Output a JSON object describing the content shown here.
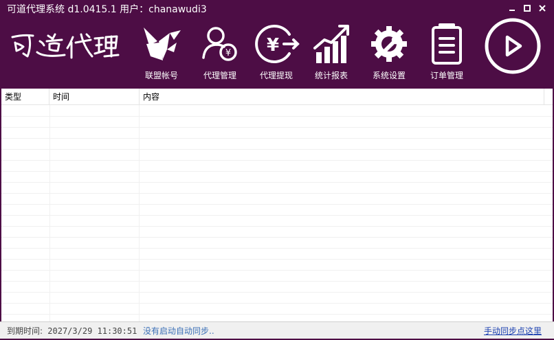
{
  "window": {
    "title": "可道代理系统 d1.0415.1 用户：chanawudi3"
  },
  "brand": {
    "logo_text": "可道代理"
  },
  "toolbar": {
    "items": [
      {
        "label": "联盟帐号",
        "icon": "origami-bird-icon"
      },
      {
        "label": "代理管理",
        "icon": "user-yen-icon"
      },
      {
        "label": "代理提现",
        "icon": "yen-withdraw-icon"
      },
      {
        "label": "统计报表",
        "icon": "bar-chart-growth-icon"
      },
      {
        "label": "系统设置",
        "icon": "gear-wrench-icon"
      },
      {
        "label": "订单管理",
        "icon": "clipboard-list-icon"
      }
    ],
    "play": {
      "icon": "play-circle-icon"
    }
  },
  "table": {
    "columns": [
      "类型",
      "时间",
      "内容"
    ],
    "rows": []
  },
  "status": {
    "expiry_label": "到期时间:",
    "expiry_value": "2027/3/29 11:30:51",
    "sync_text": "没有启动自动同步..",
    "manual_sync_link": "手动同步点这里"
  },
  "colors": {
    "chrome": "#4d0d45",
    "link": "#1a3fb0",
    "sync_text": "#3b6fb6"
  }
}
